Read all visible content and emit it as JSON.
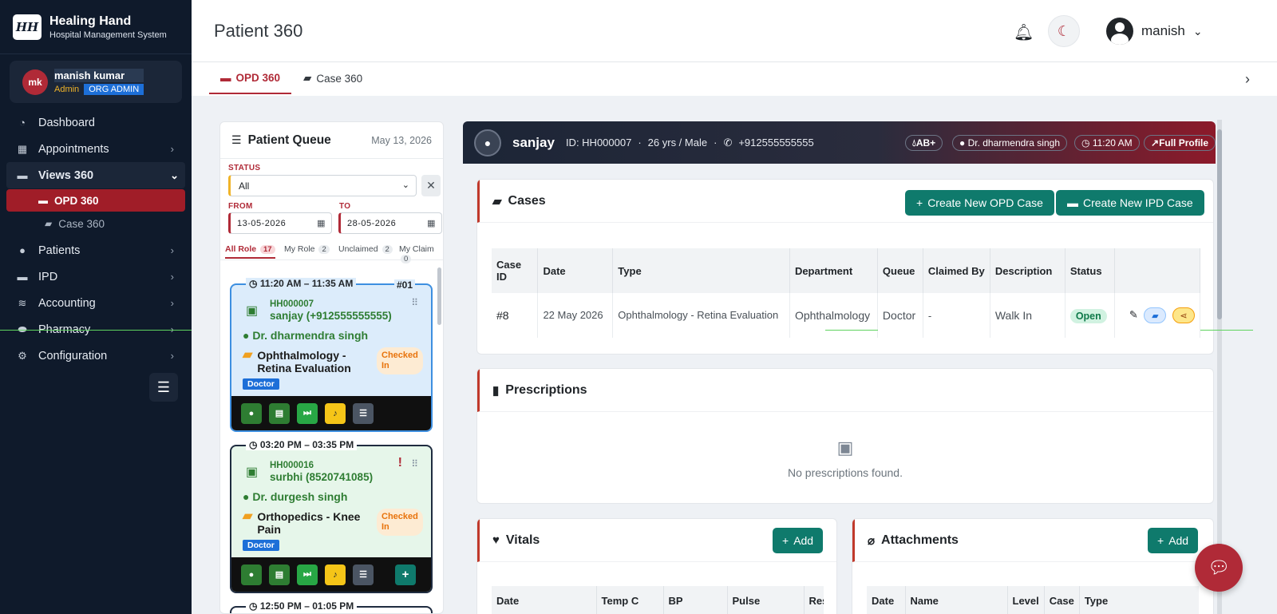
{
  "brand": {
    "logo": "HH",
    "name": "Healing Hand",
    "subtitle": "Hospital Management System"
  },
  "user": {
    "initials": "mk",
    "name": "manish kumar",
    "role": "Admin",
    "org": "ORG ADMIN",
    "menu_name": "manish"
  },
  "sidebar": {
    "items": [
      {
        "label": "Dashboard",
        "icon": "gauge-icon"
      },
      {
        "label": "Appointments",
        "icon": "calendar-icon"
      },
      {
        "label": "Views 360",
        "icon": "bed-icon"
      },
      {
        "label": "Patients",
        "icon": "user-doctor-icon"
      },
      {
        "label": "IPD",
        "icon": "bed-icon"
      },
      {
        "label": "Accounting",
        "icon": "coins-icon"
      },
      {
        "label": "Pharmacy",
        "icon": "pills-icon"
      },
      {
        "label": "Configuration",
        "icon": "gear-icon"
      }
    ],
    "sub_items": [
      {
        "label": "OPD 360"
      },
      {
        "label": "Case 360"
      }
    ]
  },
  "header": {
    "title": "Patient 360"
  },
  "tabs": [
    {
      "label": "OPD 360"
    },
    {
      "label": "Case 360"
    }
  ],
  "queue": {
    "title": "Patient Queue",
    "date": "May 13, 2026",
    "status_label": "STATUS",
    "status_value": "All",
    "from_label": "FROM",
    "from_value": "13-05-2026",
    "to_label": "TO",
    "to_value": "28-05-2026",
    "tabs": [
      {
        "label": "All Role",
        "count": "17"
      },
      {
        "label": "My Role",
        "count": "2"
      },
      {
        "label": "Unclaimed",
        "count": "2"
      },
      {
        "label": "My Claim",
        "count": "0"
      }
    ],
    "cards": [
      {
        "time": "11:20 AM – 11:35 AM",
        "number": "#01",
        "pid": "HH000007",
        "patient": "sanjay (+912555555555)",
        "doctor": "Dr. dharmendra singh",
        "case": "Ophthalmology - Retina Evaluation",
        "status": "Checked In",
        "role": "Doctor"
      },
      {
        "time": "03:20 PM – 03:35 PM",
        "number": "",
        "pid": "HH000016",
        "patient": "surbhi (8520741085)",
        "doctor": "Dr. durgesh singh",
        "case": "Orthopedics - Knee Pain",
        "status": "Checked In",
        "role": "Doctor",
        "alert": "!"
      },
      {
        "time": "12:50 PM – 01:05 PM"
      }
    ]
  },
  "patient": {
    "name": "sanjay",
    "id": "ID: HH000007",
    "age_gender": "26 yrs / Male",
    "phone": "+912555555555",
    "blood": "AB+",
    "doctor": "Dr. dharmendra singh",
    "time": "11:20 AM",
    "profile_link": "Full Profile"
  },
  "cases": {
    "title": "Cases",
    "create_opd": "Create New OPD Case",
    "create_ipd": "Create New IPD Case",
    "columns": [
      "Case ID",
      "Date",
      "Type",
      "Department",
      "Queue",
      "Claimed By",
      "Description",
      "Status",
      ""
    ],
    "rows": [
      {
        "id": "#8",
        "date": "22 May 2026",
        "type": "Ophthalmology - Retina Evaluation",
        "department": "Ophthalmology",
        "queue": "Doctor",
        "claimed_by": "-",
        "description": "Walk In",
        "status": "Open"
      }
    ]
  },
  "prescriptions": {
    "title": "Prescriptions",
    "empty": "No prescriptions found."
  },
  "vitals": {
    "title": "Vitals",
    "add": "Add",
    "columns": [
      "Date",
      "Temp C",
      "BP",
      "Pulse",
      "Resp"
    ]
  },
  "attachments": {
    "title": "Attachments",
    "add": "Add",
    "columns": [
      "Date",
      "Name",
      "Level",
      "Case",
      "Type"
    ]
  },
  "colors": {
    "sidebar": "#0f1a2b",
    "accent": "#b02a37",
    "teal": "#0f7a6c",
    "success": "#2e7d32"
  }
}
